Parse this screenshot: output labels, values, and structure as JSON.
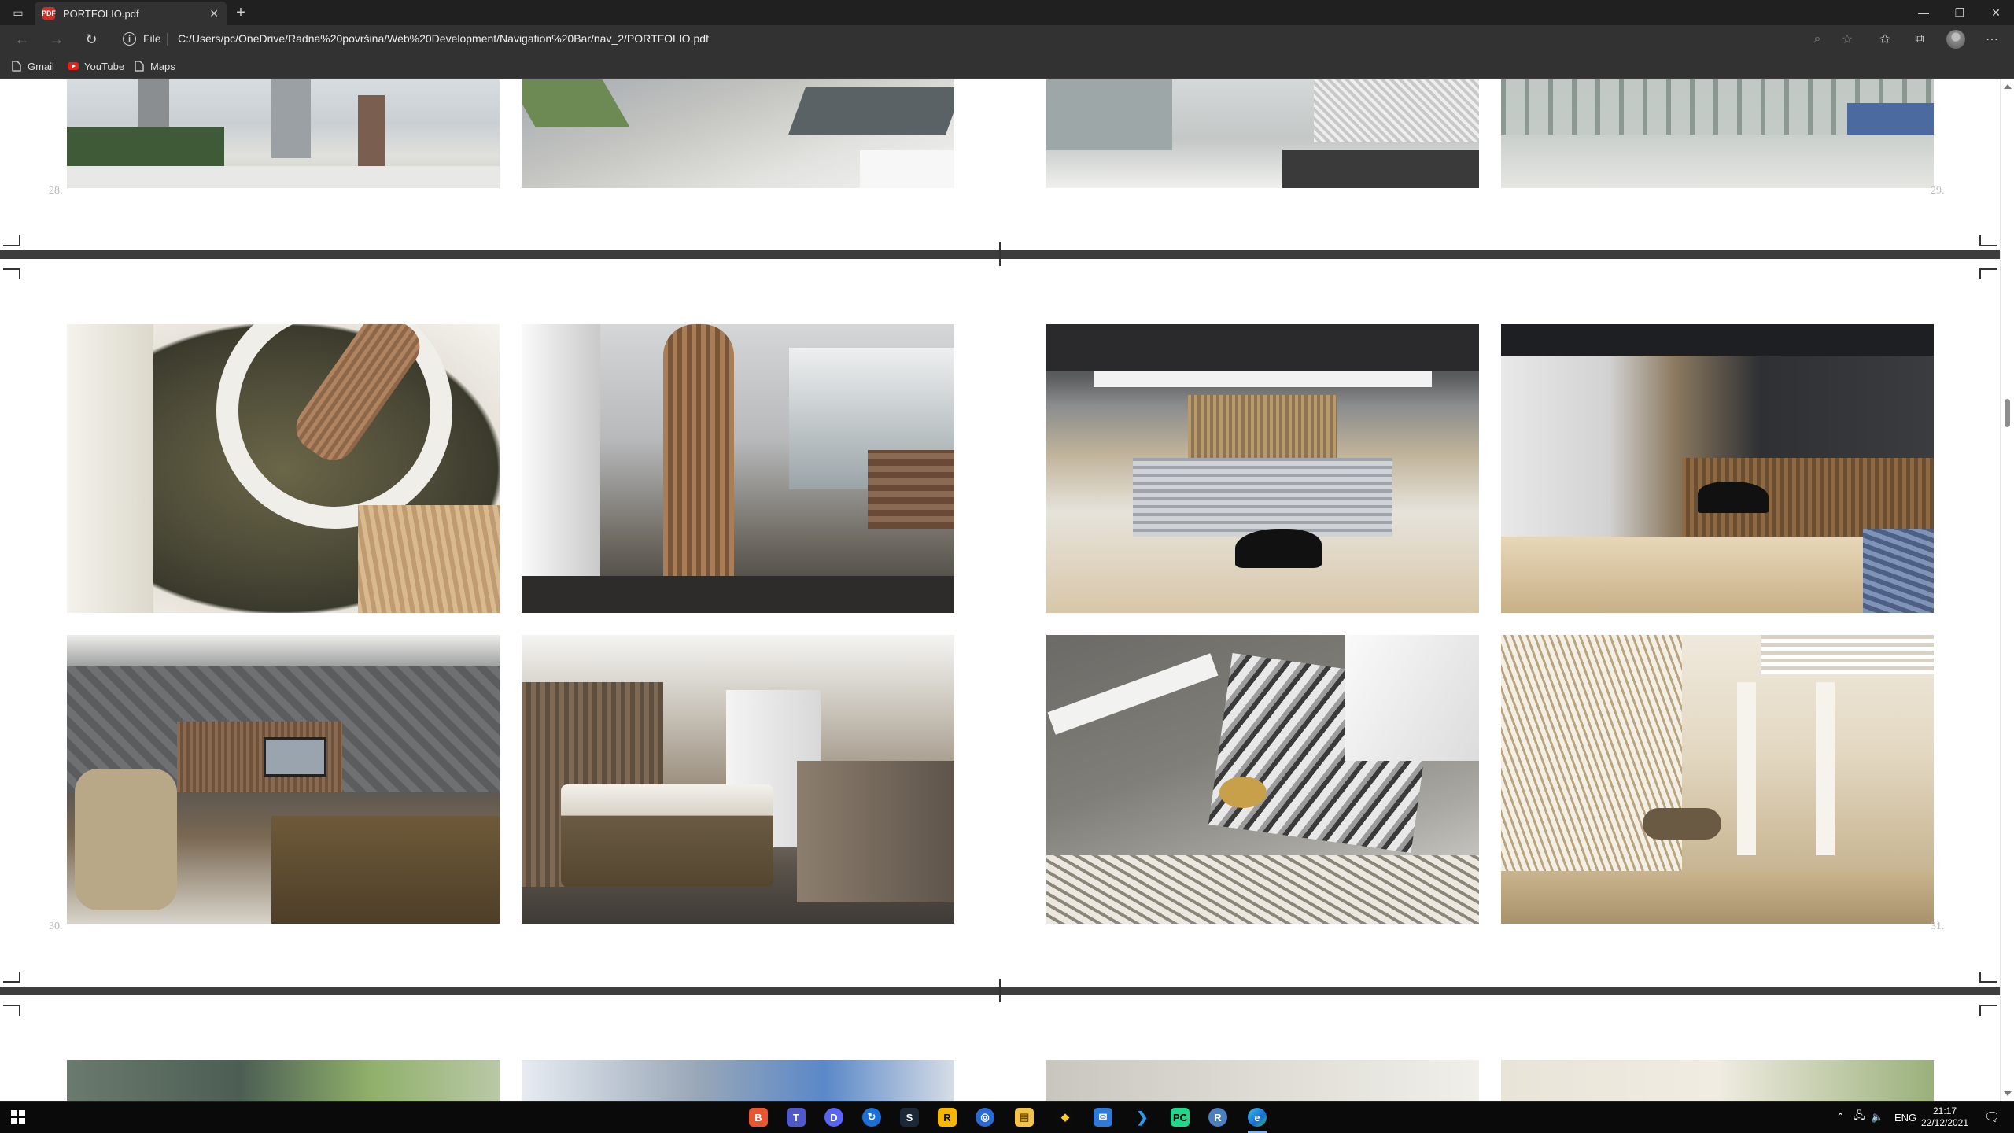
{
  "browser": {
    "tab_title": "PORTFOLIO.pdf",
    "tab_favicon": "PDF",
    "file_label": "File",
    "url": "C:/Users/pc/OneDrive/Radna%20površina/Web%20Development/Navigation%20Bar/nav_2/PORTFOLIO.pdf",
    "bookmarks": [
      {
        "label": "Gmail",
        "icon": "page-icon"
      },
      {
        "label": "YouTube",
        "icon": "youtube-icon"
      },
      {
        "label": "Maps",
        "icon": "page-icon"
      }
    ]
  },
  "pdf": {
    "page_numbers": {
      "p28": "28.",
      "p29": "29.",
      "p30": "30.",
      "p31": "31."
    }
  },
  "taskbar": {
    "apps": [
      "brave-icon",
      "teams-icon",
      "discord-icon",
      "app-icon",
      "steam-icon",
      "rockstar-icon",
      "app-icon",
      "file-explorer-icon",
      "git-icon",
      "mail-icon",
      "vscode-icon",
      "pycharm-icon",
      "r-icon",
      "edge-icon"
    ],
    "language": "ENG",
    "time": "21:17",
    "date": "22/12/2021"
  },
  "colors": {
    "chrome_dark": "#202020",
    "chrome_mid": "#323232",
    "page_bg": "#ffffff",
    "divider": "#3d3d3d"
  }
}
